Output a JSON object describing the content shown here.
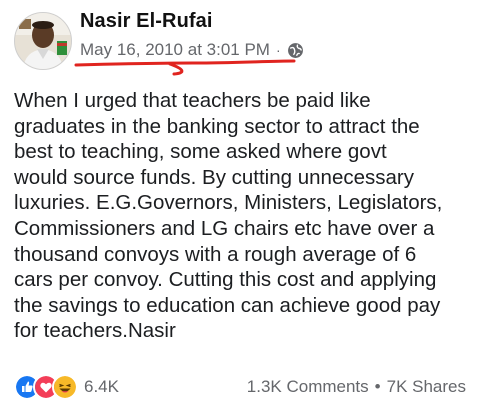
{
  "post": {
    "author_name": "Nasir El-Rufai",
    "timestamp": "May 16, 2010 at 3:01 PM",
    "separator": "·",
    "privacy_icon": "globe-icon",
    "body": "When I urged that teachers be paid like\ngraduates in the banking sector to attract the\nbest to teaching, some asked where govt\nwould source funds. By cutting unnecessary\nluxuries. E.G.Governors, Ministers, Legislators,\nCommissioners and LG chairs etc have over a\nthousand convoys with a rough average of 6\ncars per convoy. Cutting this cost and applying\nthe savings to education can achieve good pay\nfor teachers.Nasir",
    "annotation_color": "#e0241f"
  },
  "footer": {
    "reaction_icons": [
      "like-icon",
      "love-icon",
      "haha-icon"
    ],
    "reaction_count": "6.4K",
    "comments": "1.3K Comments",
    "separator": "•",
    "shares": "7K Shares"
  },
  "colors": {
    "like": "#1877f2",
    "love": "#f33e58",
    "haha": "#f7b928",
    "secondary_text": "#65676b"
  }
}
